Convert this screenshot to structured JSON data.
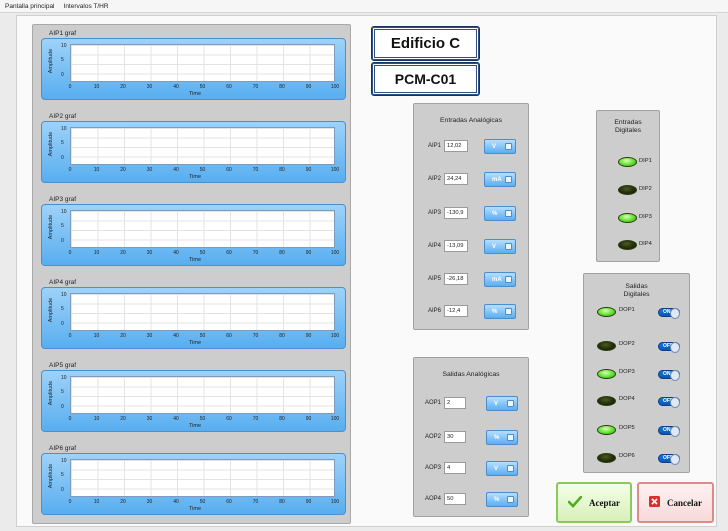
{
  "menu": {
    "items": [
      "Pantalla principal",
      "Intervalos T/HR"
    ]
  },
  "graphs": [
    {
      "title": "AIP1 graf"
    },
    {
      "title": "AIP2 graf"
    },
    {
      "title": "AIP3 graf"
    },
    {
      "title": "AIP4 graf"
    },
    {
      "title": "AIP5 graf"
    },
    {
      "title": "AIP6 graf"
    }
  ],
  "graph_axes": {
    "ylabel": "Amplitude",
    "xlabel": "Time",
    "yticks": [
      "10",
      "5",
      "0"
    ],
    "xticks": [
      "0",
      "10",
      "20",
      "30",
      "40",
      "50",
      "60",
      "70",
      "80",
      "90",
      "100"
    ]
  },
  "header": {
    "building": "Edificio C",
    "code": "PCM-C01"
  },
  "analog_inputs": {
    "title": "Entradas Analógicas",
    "rows": [
      {
        "label": "AIP1",
        "value": "12,02",
        "unit": "V"
      },
      {
        "label": "AIP2",
        "value": "24,24",
        "unit": "mA"
      },
      {
        "label": "AIP3",
        "value": "-130,9",
        "unit": "%"
      },
      {
        "label": "AIP4",
        "value": "-13,09",
        "unit": "V"
      },
      {
        "label": "AIP5",
        "value": "-26,18",
        "unit": "mA"
      },
      {
        "label": "AIP6",
        "value": "-12,4",
        "unit": "%"
      }
    ]
  },
  "analog_outputs": {
    "title": "Salidas Analógicas",
    "rows": [
      {
        "label": "AOP1",
        "value": "2",
        "unit": "V"
      },
      {
        "label": "AOP2",
        "value": "30",
        "unit": "%"
      },
      {
        "label": "AOP3",
        "value": "4",
        "unit": "V"
      },
      {
        "label": "AOP4",
        "value": "50",
        "unit": "%"
      }
    ]
  },
  "digital_inputs": {
    "title_line1": "Entradas",
    "title_line2": "Digitales",
    "rows": [
      {
        "label": "DIP1",
        "state": "on"
      },
      {
        "label": "DIP2",
        "state": "off"
      },
      {
        "label": "DIP3",
        "state": "on"
      },
      {
        "label": "DIP4",
        "state": "off"
      }
    ]
  },
  "digital_outputs": {
    "title_line1": "Salidas",
    "title_line2": "Digitales",
    "rows": [
      {
        "label": "DOP1",
        "state": "on",
        "toggle": "ON"
      },
      {
        "label": "DOP2",
        "state": "off",
        "toggle": "OFF"
      },
      {
        "label": "DOP3",
        "state": "on",
        "toggle": "ON"
      },
      {
        "label": "DOP4",
        "state": "off",
        "toggle": "OFF"
      },
      {
        "label": "DOP5",
        "state": "on",
        "toggle": "ON"
      },
      {
        "label": "DOP6",
        "state": "off",
        "toggle": "OFF"
      }
    ]
  },
  "buttons": {
    "accept": "Aceptar",
    "cancel": "Cancelar"
  },
  "colors": {
    "led_on": "#5ee12e",
    "led_off": "#1f2b0a",
    "graph_frame": "#58aef0",
    "toggle": "#0a55b5"
  }
}
